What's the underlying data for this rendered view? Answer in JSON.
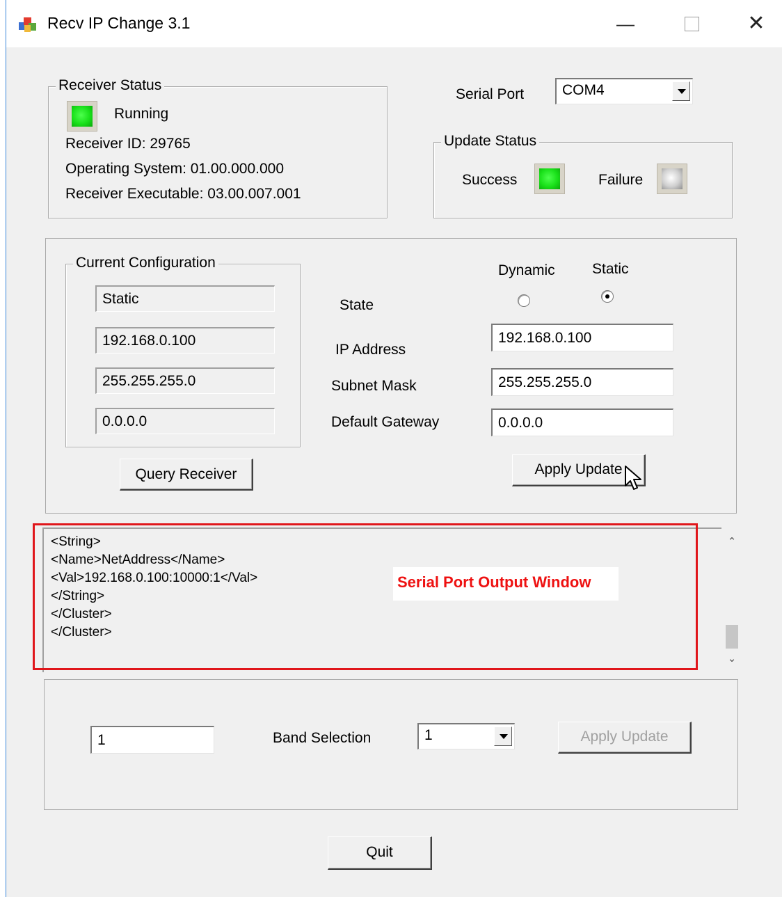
{
  "window": {
    "title": "Recv IP Change 3.1",
    "icon": "app-icon",
    "controls": [
      "minimize-icon",
      "maximize-icon",
      "close-icon"
    ]
  },
  "receiver_status": {
    "legend": "Receiver Status",
    "state_text": "Running",
    "state_led": "on",
    "receiver_id": "Receiver ID: 29765",
    "operating_system": "Operating System: 01.00.000.000",
    "receiver_executable": "Receiver Executable: 03.00.007.001"
  },
  "serial_port": {
    "label": "Serial Port",
    "value": "COM4"
  },
  "update_status": {
    "legend": "Update Status",
    "success_label": "Success",
    "success_led": "on",
    "failure_label": "Failure",
    "failure_led": "off"
  },
  "current_config": {
    "legend": "Current Configuration",
    "state": "Static",
    "ip_address": "192.168.0.100",
    "subnet_mask": "255.255.255.0",
    "default_gateway": "0.0.0.0"
  },
  "new_config": {
    "dynamic_label": "Dynamic",
    "static_label": "Static",
    "selected": "Static",
    "state_label": "State",
    "ip_label": "IP Address",
    "subnet_label": "Subnet Mask",
    "gateway_label": "Default Gateway",
    "ip_value": "192.168.0.100",
    "subnet_value": "255.255.255.0",
    "gateway_value": "0.0.0.0"
  },
  "buttons": {
    "query": "Query Receiver",
    "apply": "Apply Update",
    "band_apply": "Apply Update",
    "quit": "Quit"
  },
  "output": {
    "lines": [
      "<String>",
      "<Name>NetAddress</Name>",
      "<Val>192.168.0.100:10000:1</Val>",
      "</String>",
      "</Cluster>",
      "</Cluster>"
    ],
    "annotation": "Serial Port Output Window"
  },
  "band": {
    "input_value": "1",
    "label": "Band Selection",
    "select_value": "1"
  },
  "colors": {
    "led_on": "#19e019",
    "led_off": "#cfcfcf",
    "annotation_red": "#e0161b",
    "window_bg": "#f0f0f0"
  }
}
